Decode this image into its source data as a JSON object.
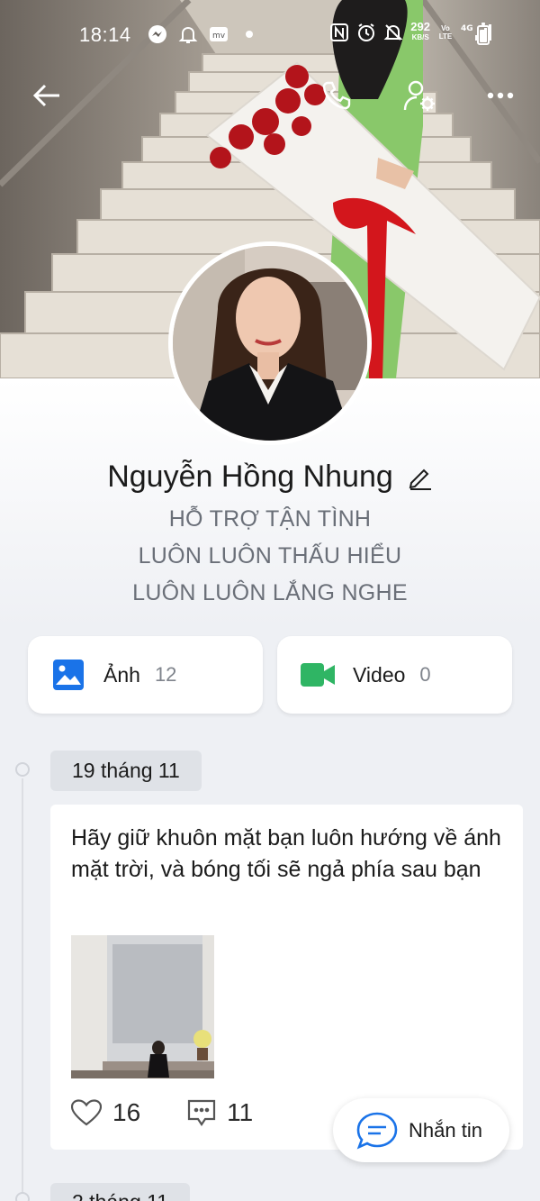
{
  "status_bar": {
    "time": "18:14",
    "net_speed_value": "292",
    "net_speed_unit": "KB/S",
    "volte_label": "Vo LTE",
    "network_label": "4G"
  },
  "header": {
    "back_icon": "arrow-left-icon",
    "call_icon": "phone-icon",
    "settings_icon": "user-settings-icon",
    "more_icon": "more-horizontal-icon"
  },
  "profile": {
    "name": "Nguyễn Hồng Nhung",
    "bio_lines": [
      "HỖ TRỢ TẬN TÌNH",
      "LUÔN LUÔN THẤU HIỂU",
      "LUÔN LUÔN LẮNG NGHE"
    ]
  },
  "media": {
    "photos": {
      "label": "Ảnh",
      "count": "12",
      "icon": "image-icon",
      "color": "#1a73e8"
    },
    "videos": {
      "label": "Video",
      "count": "0",
      "icon": "video-camera-icon",
      "color": "#2fb564"
    }
  },
  "timeline": {
    "date": "19 tháng 11",
    "next_date": "2 tháng 11",
    "post": {
      "text": "Hãy giữ khuôn mặt bạn luôn hướng về ánh mặt trời, và bóng tối sẽ ngả phía sau bạn",
      "likes": "16",
      "comments": "11"
    }
  },
  "chat_button": {
    "label": "Nhắn tin",
    "icon": "chat-bubble-icon",
    "color": "#1a73e8"
  }
}
